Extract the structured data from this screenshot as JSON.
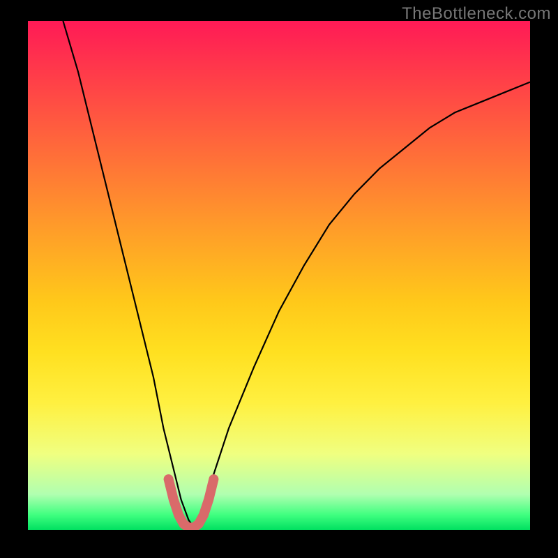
{
  "watermark": "TheBottleneck.com",
  "chart_data": {
    "type": "line",
    "title": "",
    "xlabel": "",
    "ylabel": "",
    "xlim": [
      0,
      100
    ],
    "ylim": [
      0,
      100
    ],
    "series": [
      {
        "name": "bottleneck-curve",
        "x": [
          7,
          10,
          13,
          16,
          19,
          22,
          25,
          27,
          29,
          30.5,
          32,
          33,
          34,
          36,
          40,
          45,
          50,
          55,
          60,
          65,
          70,
          75,
          80,
          85,
          90,
          95,
          100
        ],
        "y": [
          100,
          90,
          78,
          66,
          54,
          42,
          30,
          20,
          12,
          6,
          2,
          0.5,
          2,
          8,
          20,
          32,
          43,
          52,
          60,
          66,
          71,
          75,
          79,
          82,
          84,
          86,
          88
        ]
      },
      {
        "name": "optimal-region",
        "x": [
          28,
          29,
          30,
          31,
          32,
          33,
          34,
          35,
          36,
          37
        ],
        "y": [
          10,
          6,
          3,
          1.2,
          0.5,
          0.5,
          1.2,
          3,
          6,
          10
        ]
      }
    ],
    "colors": {
      "curve": "#000000",
      "optimal": "#d96a6a"
    }
  }
}
